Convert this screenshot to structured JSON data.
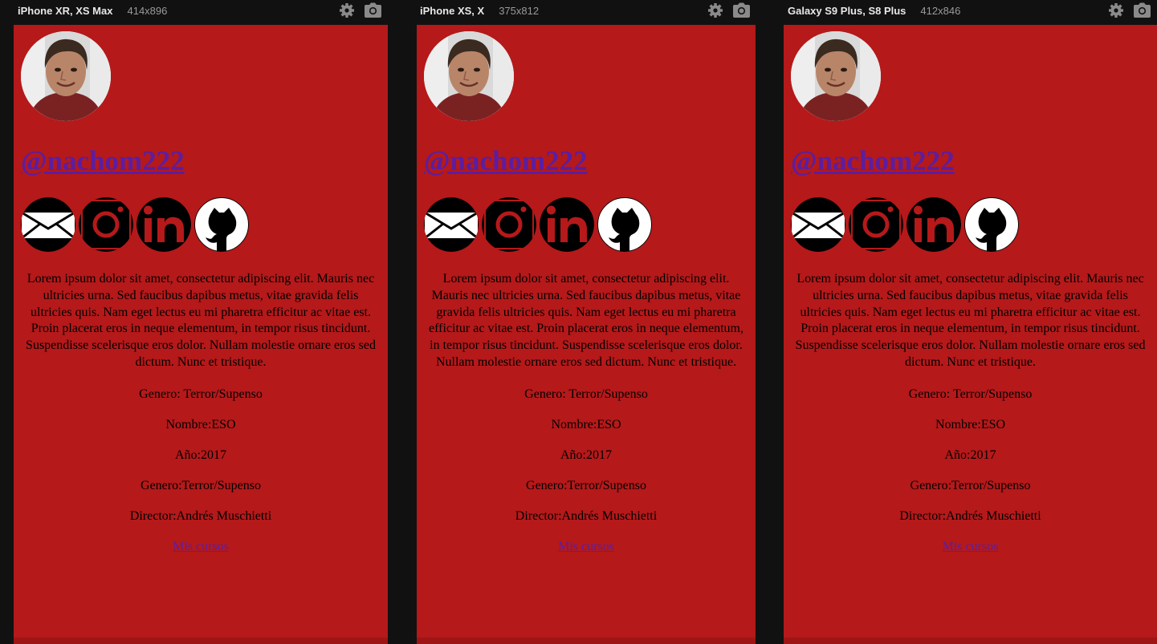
{
  "devices": [
    {
      "name": "iPhone XR, XS Max",
      "size": "414x896"
    },
    {
      "name": "iPhone XS, X",
      "size": "375x812"
    },
    {
      "name": "Galaxy S9 Plus, S8 Plus",
      "size": "412x846"
    }
  ],
  "profile": {
    "handle": "@nachom222",
    "bio": "Lorem ipsum dolor sit amet, consectetur adipiscing elit. Mauris nec ultricies urna. Sed faucibus dapibus metus, vitae gravida felis ultricies quis. Nam eget lectus eu mi pharetra efficitur ac vitae est. Proin placerat eros in neque elementum, in tempor risus tincidunt. Suspendisse scelerisque eros dolor. Nullam molestie ornare eros sed dictum. Nunc et tristique.",
    "genre": "Genero: Terror/Supenso",
    "name": "Nombre:ESO",
    "year": "Año:2017",
    "genre2": "Genero:Terror/Supenso",
    "director": "Director:Andrés Muschietti",
    "courses_link": "Mis cursos"
  },
  "socials": [
    "mail-icon",
    "instagram-icon",
    "linkedin-icon",
    "github-icon"
  ],
  "colors": {
    "background": "#111111",
    "page": "#b5191a",
    "link": "#5a1ea3",
    "text": "#000000"
  }
}
